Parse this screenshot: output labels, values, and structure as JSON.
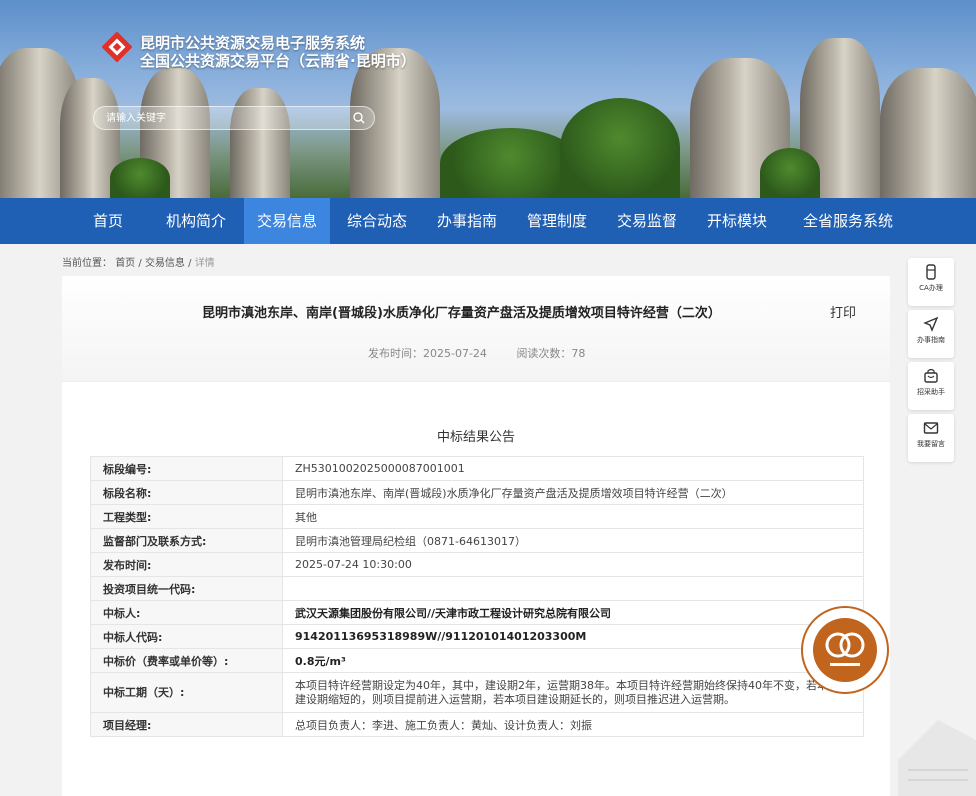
{
  "header": {
    "title_line1": "昆明市公共资源交易电子服务系统",
    "title_line2": "全国公共资源交易平台（云南省·昆明市）",
    "search_placeholder": "请输入关键字"
  },
  "nav": {
    "items": [
      "首页",
      "机构简介",
      "交易信息",
      "综合动态",
      "办事指南",
      "管理制度",
      "交易监督",
      "开标模块",
      "全省服务系统"
    ],
    "active_index": 2
  },
  "breadcrumb": {
    "prefix": "当前位置：",
    "home": "首页",
    "sep": "/",
    "section": "交易信息",
    "current": "详情"
  },
  "article": {
    "title": "昆明市滇池东岸、南岸(晋城段)水质净化厂存量资产盘活及提质增效项目特许经营（二次）",
    "print_label": "打印",
    "publish_label": "发布时间：2025-07-24",
    "views_label": "阅读次数：78",
    "notice_title": "中标结果公告"
  },
  "table": {
    "rows": [
      {
        "key": "标段编号:",
        "value": "ZH5301002025000087001001",
        "bold": false
      },
      {
        "key": "标段名称:",
        "value": "昆明市滇池东岸、南岸(晋城段)水质净化厂存量资产盘活及提质增效项目特许经营（二次）",
        "bold": false
      },
      {
        "key": "工程类型:",
        "value": "其他",
        "bold": false
      },
      {
        "key": "监督部门及联系方式:",
        "value": "昆明市滇池管理局纪检组（0871-64613017）",
        "bold": false
      },
      {
        "key": "发布时间:",
        "value": "2025-07-24 10:30:00",
        "bold": false
      },
      {
        "key": "投资项目统一代码:",
        "value": "",
        "bold": false
      },
      {
        "key": "中标人:",
        "value": "武汉天源集团股份有限公司//天津市政工程设计研究总院有限公司",
        "bold": true
      },
      {
        "key": "中标人代码:",
        "value": "91420113695318989W//91120101401203300M",
        "bold": true
      },
      {
        "key": "中标价（费率或单价等）:",
        "value": "0.8元/m³",
        "bold": true
      },
      {
        "key": "中标工期（天）:",
        "value": "本项目特许经营期设定为40年，其中，建设期2年，运营期38年。本项目特许经营期始终保持40年不变，若本项目建设期缩短的，则项目提前进入运营期，若本项目建设期延长的，则项目推迟进入运营期。",
        "bold": false
      },
      {
        "key": "项目经理:",
        "value": "总项目负责人：李进、施工负责人：黄灿、设计负责人：刘振",
        "bold": false
      }
    ]
  },
  "sidebar": {
    "items": [
      {
        "label": "CA办理",
        "icon": "usb-key-icon"
      },
      {
        "label": "办事指南",
        "icon": "send-icon"
      },
      {
        "label": "招采助手",
        "icon": "shopping-bag-icon"
      },
      {
        "label": "我要留言",
        "icon": "mail-icon"
      }
    ]
  },
  "colors": {
    "nav_bg": "#1f5fb4",
    "nav_active": "#3c86e0",
    "seal": "#c0641e",
    "logo_red": "#e0302a"
  }
}
